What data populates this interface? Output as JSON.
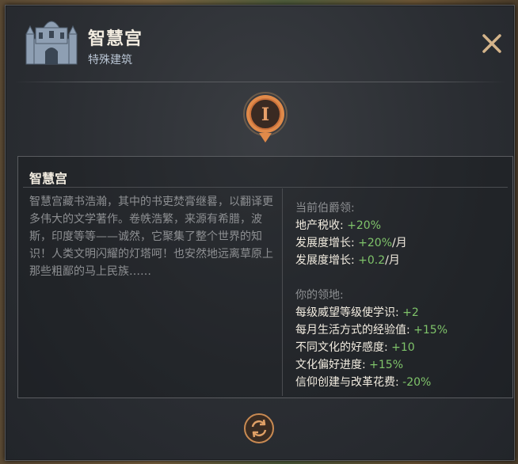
{
  "header": {
    "title": "智慧宫",
    "subtitle": "特殊建筑",
    "building_icon": "palace-building-icon",
    "close_icon": "close-icon"
  },
  "badge": {
    "tier": "I",
    "icon": "tier-medallion-icon"
  },
  "info": {
    "title": "智慧宫",
    "description": "智慧宫藏书浩瀚，其中的书吏焚膏继晷，以翻译更多伟大的文学著作。卷帙浩繁，来源有希腊，波斯，印度等等——诚然，它聚集了整个世界的知识！人类文明闪耀的灯塔呵！也安然地远离草原上那些粗鄙的马上民族……",
    "holder_section": {
      "heading": "当前伯爵领:",
      "effects": [
        {
          "label": "地产税收: ",
          "value": "+20%",
          "suffix": ""
        },
        {
          "label": "发展度增长: ",
          "value": "+20%",
          "suffix": "/月"
        },
        {
          "label": "发展度增长: ",
          "value": "+0.2",
          "suffix": "/月"
        }
      ]
    },
    "realm_section": {
      "heading": "你的领地:",
      "effects": [
        {
          "label": "每级威望等级使学识: ",
          "value": "+2",
          "suffix": ""
        },
        {
          "label": "每月生活方式的经验值: ",
          "value": "+15%",
          "suffix": ""
        },
        {
          "label": "不同文化的好感度: ",
          "value": "+10",
          "suffix": ""
        },
        {
          "label": "文化偏好进度: ",
          "value": "+15%",
          "suffix": ""
        },
        {
          "label": "信仰创建与改革花费: ",
          "value": "-20%",
          "suffix": ""
        }
      ]
    }
  },
  "footer": {
    "cycle_icon": "cycle-arrows-icon"
  },
  "colors": {
    "positive": "#7fc46a",
    "accent_orange": "#e08a4a",
    "title_text": "#f2ece0",
    "muted_text": "#8d8f92"
  }
}
